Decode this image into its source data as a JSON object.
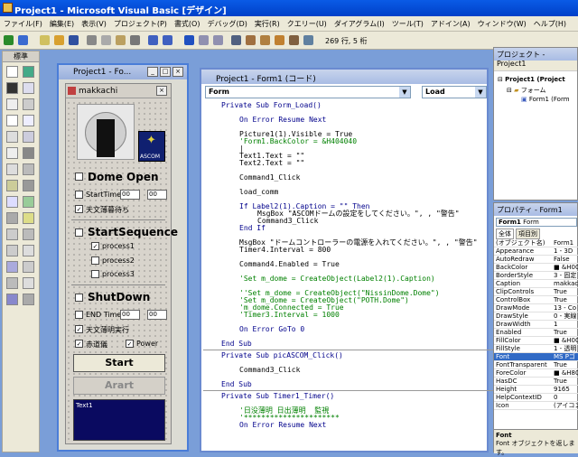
{
  "titlebar": {
    "title": "Project1 - Microsoft Visual Basic [デザイン]"
  },
  "menu": [
    "ファイル(F)",
    "編集(E)",
    "表示(V)",
    "プロジェクト(P)",
    "書式(O)",
    "デバッグ(D)",
    "実行(R)",
    "クエリー(U)",
    "ダイアグラム(I)",
    "ツール(T)",
    "アドイン(A)",
    "ウィンドウ(W)",
    "ヘルプ(H)"
  ],
  "toolbar": {
    "position": "269 行, 5 桁"
  },
  "toolbox": {
    "title": "標準"
  },
  "formwin": {
    "title": "Project1 - Fo..."
  },
  "form": {
    "title": "makkachi",
    "logo_text": "ASCOM",
    "dome_open": "Dome Open",
    "start_time": "StartTime",
    "hour": "00",
    "minute": "00",
    "weather_wait": "天文薄暮待ち",
    "start_sequence": "StartSequence",
    "process1": "process1",
    "process2": "process2",
    "process3": "process3",
    "shutdown": "ShutDown",
    "end_time": "END Time",
    "dawn_exec": "天文薄明実行",
    "red_eq": "赤道儀",
    "power": "Power",
    "start_btn": "Start",
    "abort_btn": "Arart",
    "list_text": "Text1"
  },
  "codewin": {
    "title": "Project1 - Form1 (コード)",
    "object": "Form",
    "proc": "Load",
    "lines": [
      {
        "t": "Private Sub Form_Load()",
        "c": "kw",
        "i": 0
      },
      {
        "t": "",
        "c": "",
        "i": 0
      },
      {
        "t": "On Error Resume Next",
        "c": "kw",
        "i": 1
      },
      {
        "t": "",
        "c": "",
        "i": 0
      },
      {
        "t": "Picture1(1).Visible = True",
        "c": "",
        "i": 1
      },
      {
        "t": "'Form1.BackColor = &H404040",
        "c": "cm",
        "i": 1
      },
      {
        "t": "|",
        "c": "",
        "i": 1
      },
      {
        "t": "Text1.Text = \"\"",
        "c": "",
        "i": 1
      },
      {
        "t": "Text2.Text = \"\"",
        "c": "",
        "i": 1
      },
      {
        "t": "",
        "c": "",
        "i": 0
      },
      {
        "t": "Command1_Click",
        "c": "",
        "i": 1
      },
      {
        "t": "",
        "c": "",
        "i": 0
      },
      {
        "t": "load_comm",
        "c": "",
        "i": 1
      },
      {
        "t": "",
        "c": "",
        "i": 0
      },
      {
        "t": "If Label2(1).Caption = \"\" Then",
        "c": "kw",
        "i": 1
      },
      {
        "t": "MsgBox \"ASCOMドームの設定をしてください。\", , \"警告\"",
        "c": "",
        "i": 2
      },
      {
        "t": "Command3_Click",
        "c": "",
        "i": 2
      },
      {
        "t": "End If",
        "c": "kw",
        "i": 1
      },
      {
        "t": "",
        "c": "",
        "i": 0
      },
      {
        "t": "MsgBox \"ドームコントローラーの電源を入れてください。\", , \"警告\"",
        "c": "",
        "i": 1
      },
      {
        "t": "Timer4.Interval = 800",
        "c": "",
        "i": 1
      },
      {
        "t": "",
        "c": "",
        "i": 0
      },
      {
        "t": "Command4.Enabled = True",
        "c": "",
        "i": 1
      },
      {
        "t": "",
        "c": "",
        "i": 0
      },
      {
        "t": "'Set m_dome = CreateObject(Label2(1).Caption)",
        "c": "cm",
        "i": 1
      },
      {
        "t": "",
        "c": "",
        "i": 0
      },
      {
        "t": "''Set m_dome = CreateObject(\"NissinDome.Dome\")",
        "c": "cm",
        "i": 1
      },
      {
        "t": "'Set m_dome = CreateObject(\"POTH.Dome\")",
        "c": "cm",
        "i": 1
      },
      {
        "t": "'m_dome.Connected = True",
        "c": "cm",
        "i": 1
      },
      {
        "t": "'Timer3.Interval = 1000",
        "c": "cm",
        "i": 1
      },
      {
        "t": "",
        "c": "",
        "i": 0
      },
      {
        "t": "On Error GoTo 0",
        "c": "kw",
        "i": 1
      },
      {
        "t": "",
        "c": "",
        "i": 0
      },
      {
        "t": "End Sub",
        "c": "kw",
        "i": 0
      },
      {
        "t": "---",
        "c": "sep",
        "i": 0
      },
      {
        "t": "Private Sub picASCOM_Click()",
        "c": "kw",
        "i": 0
      },
      {
        "t": "",
        "c": "",
        "i": 0
      },
      {
        "t": "Command3_Click",
        "c": "",
        "i": 1
      },
      {
        "t": "",
        "c": "",
        "i": 0
      },
      {
        "t": "End Sub",
        "c": "kw",
        "i": 0
      },
      {
        "t": "---",
        "c": "sep",
        "i": 0
      },
      {
        "t": "Private Sub Timer1_Timer()",
        "c": "kw",
        "i": 0
      },
      {
        "t": "",
        "c": "",
        "i": 0
      },
      {
        "t": "'日没薄明 日出薄明  監視",
        "c": "cm",
        "i": 1
      },
      {
        "t": "'**********************",
        "c": "cm",
        "i": 1
      },
      {
        "t": "On Error Resume Next",
        "c": "kw",
        "i": 1
      }
    ]
  },
  "project": {
    "title": "プロジェクト - Project1",
    "root": "Project1 (Project",
    "folder": "フォーム",
    "item": "Form1 (Form"
  },
  "properties": {
    "title": "プロパティ - Form1",
    "object": "Form1",
    "object_type": "Form",
    "tab_all": "全体",
    "tab_cat": "項目別",
    "rows": [
      [
        "(オブジェクト名)",
        "Form1"
      ],
      [
        "Appearance",
        "1 - 3D"
      ],
      [
        "AutoRedraw",
        "False"
      ],
      [
        "BackColor",
        "■ &H000"
      ],
      [
        "BorderStyle",
        "3 - 固定"
      ],
      [
        "Caption",
        "makkach"
      ],
      [
        "ClipControls",
        "True"
      ],
      [
        "ControlBox",
        "True"
      ],
      [
        "DrawMode",
        "13 - Co"
      ],
      [
        "DrawStyle",
        "0 - 実線"
      ],
      [
        "DrawWidth",
        "1"
      ],
      [
        "Enabled",
        "True"
      ],
      [
        "FillColor",
        "■ &H00"
      ],
      [
        "FillStyle",
        "1 - 透明"
      ],
      [
        "Font",
        "MS Pゴ"
      ],
      [
        "FontTransparent",
        "True"
      ],
      [
        "ForeColor",
        "■ &H80"
      ],
      [
        "HasDC",
        "True"
      ],
      [
        "Height",
        "9165"
      ],
      [
        "HelpContextID",
        "0"
      ],
      [
        "Icon",
        "(アイコン)"
      ]
    ],
    "desc_title": "Font",
    "desc_text": "Font オブジェクトを返します。"
  }
}
